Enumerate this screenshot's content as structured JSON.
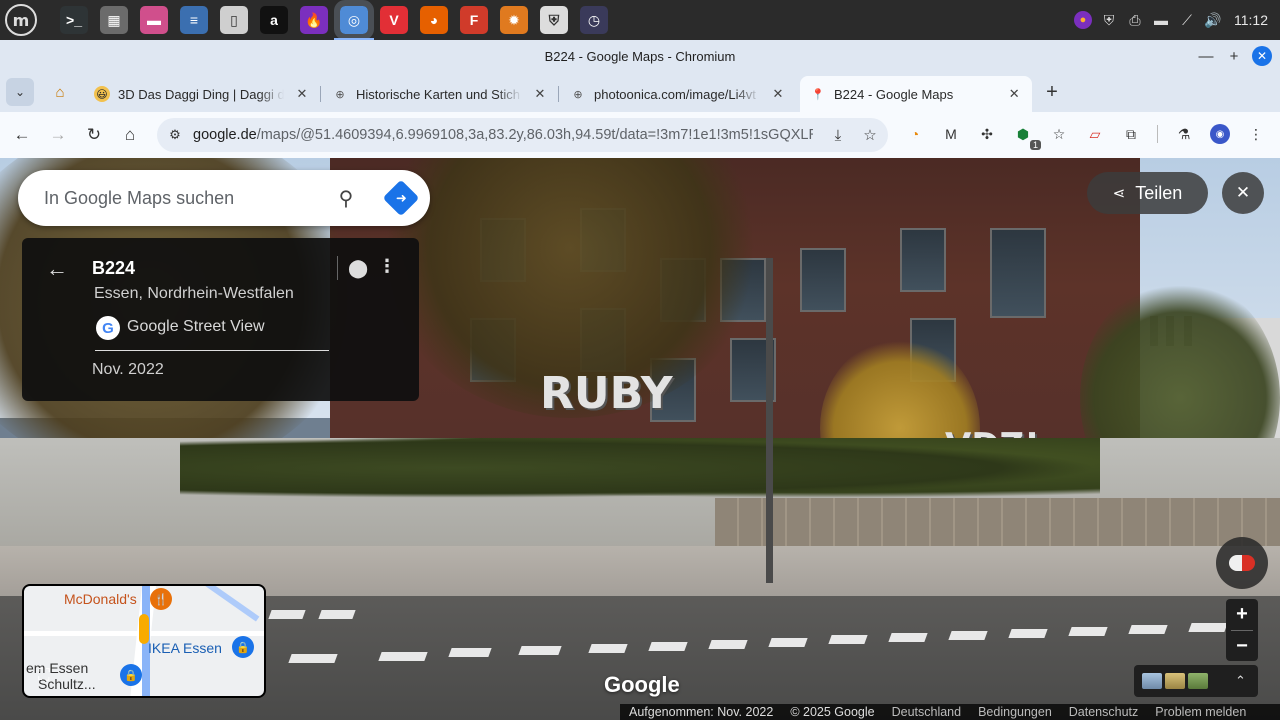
{
  "taskbar": {
    "launchers": [
      {
        "name": "terminal-icon",
        "color": "#2e3436",
        "glyph": ">_"
      },
      {
        "name": "calculator-icon",
        "color": "#6b6b6b",
        "glyph": "▦"
      },
      {
        "name": "files-icon",
        "color": "#d04f8c",
        "glyph": "▬"
      },
      {
        "name": "text-editor-icon",
        "color": "#3b6fb0",
        "glyph": "≡"
      },
      {
        "name": "notes-icon",
        "color": "#cfcfcf",
        "glyph": "▯"
      },
      {
        "name": "amazon-icon",
        "color": "#111111",
        "glyph": "a"
      },
      {
        "name": "firefox-alt-icon",
        "color": "#7b2fbe",
        "glyph": "🔥"
      },
      {
        "name": "chromium-icon",
        "color": "#4f8bd6",
        "glyph": "◎"
      },
      {
        "name": "vivaldi-icon",
        "color": "#e22f36",
        "glyph": "V"
      },
      {
        "name": "firefox-icon",
        "color": "#e66000",
        "glyph": "◕"
      },
      {
        "name": "flathub-icon",
        "color": "#d03b2a",
        "glyph": "F"
      },
      {
        "name": "gear-app-icon",
        "color": "#e07a1f",
        "glyph": "✹"
      },
      {
        "name": "shield-app-icon",
        "color": "#dddddd",
        "glyph": "⛨"
      },
      {
        "name": "clock-app-icon",
        "color": "#3a3a5a",
        "glyph": "◷"
      }
    ],
    "clock": "11:12"
  },
  "window": {
    "title": "B224 - Google Maps - Chromium"
  },
  "tabs": [
    {
      "label": "3D Das Daggi Ding | Daggi de",
      "favicon": "😃",
      "favicon_bg": "#f2c14e"
    },
    {
      "label": "Historische Karten und Stich",
      "favicon": "⊕",
      "favicon_bg": "#e8e8e8"
    },
    {
      "label": "photoonica.com/image/Li4vt",
      "favicon": "⊕",
      "favicon_bg": "#e8e8e8"
    },
    {
      "label": "B224 - Google Maps",
      "favicon": "📍",
      "favicon_bg": "transparent"
    }
  ],
  "omnibox": {
    "host": "google.de",
    "path": "/maps/@51.4609394,6.9969108,3a,83.2y,86.03h,94.59t/data=!3m7!1e1!3m5!1sGQXLR..."
  },
  "maps": {
    "search_placeholder": "In Google Maps suchen",
    "place": {
      "title": "B224",
      "subtitle": "Essen, Nordrhein-Westfalen",
      "source": "Google Street View",
      "date": "Nov. 2022"
    },
    "share_label": "Teilen",
    "watermark": "Google",
    "minimap": {
      "labels": [
        "McDonald's",
        "IKEA Essen",
        "em Essen",
        "Schultz..."
      ]
    },
    "footer": {
      "captured": "Aufgenommen: Nov. 2022",
      "copyright": "© 2025 Google",
      "country": "Deutschland",
      "terms": "Bedingungen",
      "privacy": "Datenschutz",
      "report": "Problem melden"
    }
  },
  "colors": {
    "accent": "#1a73e8",
    "tab_strip": "#dfe7f2",
    "toolbar": "#f7fafe"
  }
}
